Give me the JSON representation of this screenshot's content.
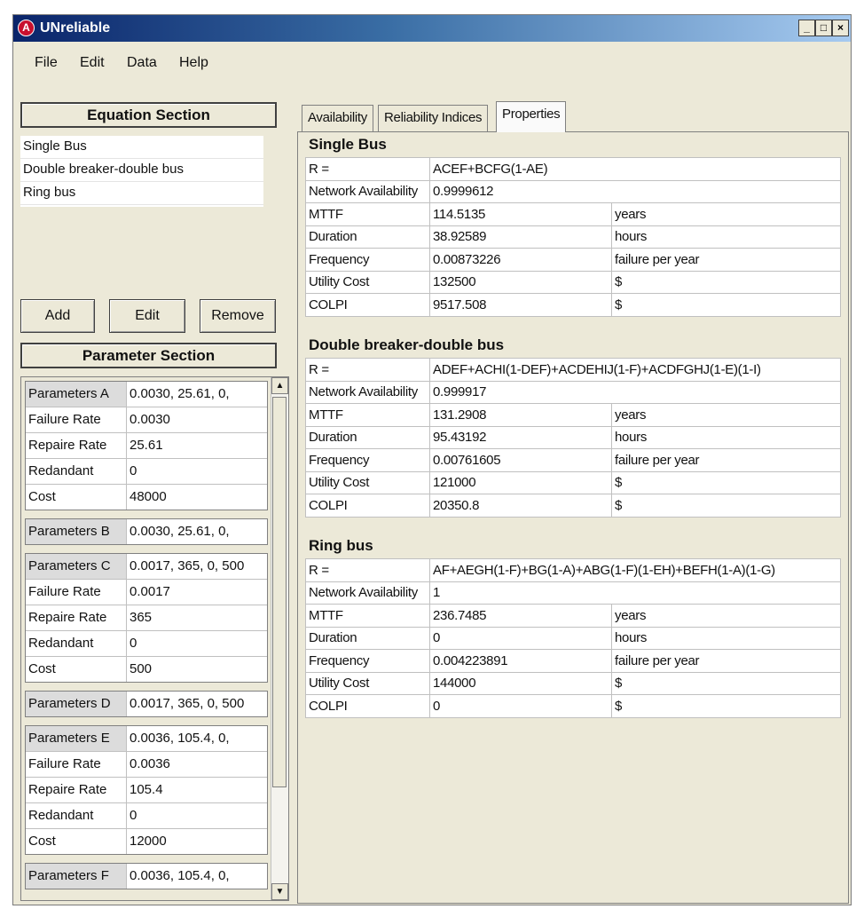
{
  "window": {
    "title": "UNreliable"
  },
  "titlebar_buttons": {
    "minimize": "_",
    "maximize": "□",
    "close": "×"
  },
  "menu": [
    "File",
    "Edit",
    "Data",
    "Help"
  ],
  "equation_section": {
    "title": "Equation Section",
    "items": [
      "Single Bus",
      "Double breaker-double bus",
      "Ring bus"
    ],
    "buttons": {
      "add": "Add",
      "edit": "Edit",
      "remove": "Remove"
    }
  },
  "parameter_section": {
    "title": "Parameter Section",
    "groups": [
      {
        "header": "Parameters A",
        "summary": "0.0030, 25.61, 0,",
        "expanded": true,
        "rows": [
          [
            "Failure Rate",
            "0.0030"
          ],
          [
            "Repaire Rate",
            "25.61"
          ],
          [
            "Redandant",
            "0"
          ],
          [
            "Cost",
            "48000"
          ]
        ]
      },
      {
        "header": "Parameters B",
        "summary": "0.0030, 25.61, 0,",
        "expanded": false,
        "rows": []
      },
      {
        "header": "Parameters C",
        "summary": "0.0017, 365, 0, 500",
        "expanded": true,
        "rows": [
          [
            "Failure Rate",
            "0.0017"
          ],
          [
            "Repaire Rate",
            "365"
          ],
          [
            "Redandant",
            "0"
          ],
          [
            "Cost",
            "500"
          ]
        ]
      },
      {
        "header": "Parameters D",
        "summary": "0.0017, 365, 0, 500",
        "expanded": false,
        "rows": []
      },
      {
        "header": "Parameters E",
        "summary": "0.0036, 105.4, 0,",
        "expanded": true,
        "rows": [
          [
            "Failure Rate",
            "0.0036"
          ],
          [
            "Repaire Rate",
            "105.4"
          ],
          [
            "Redandant",
            "0"
          ],
          [
            "Cost",
            "12000"
          ]
        ]
      },
      {
        "header": "Parameters F",
        "summary": "0.0036, 105.4, 0,",
        "expanded": false,
        "rows": []
      }
    ],
    "scroll_up": "▲",
    "scroll_down": "▼"
  },
  "tabs": [
    "Availability",
    "Reliability Indices",
    "Properties"
  ],
  "active_tab": "Properties",
  "properties": [
    {
      "title": "Single Bus",
      "rows": [
        [
          "R =",
          "ACEF+BCFG(1-AE)",
          ""
        ],
        [
          "Network Availability",
          "0.9999612",
          ""
        ],
        [
          "MTTF",
          "114.5135",
          "years"
        ],
        [
          "Duration",
          "38.92589",
          "hours"
        ],
        [
          "Frequency",
          "0.00873226",
          "failure per year"
        ],
        [
          "Utility Cost",
          "132500",
          "$"
        ],
        [
          "COLPI",
          "9517.508",
          "$"
        ]
      ]
    },
    {
      "title": "Double breaker-double bus",
      "rows": [
        [
          "R =",
          "ADEF+ACHI(1-DEF)+ACDEHIJ(1-F)+ACDFGHJ(1-E)(1-I)",
          ""
        ],
        [
          "Network Availability",
          "0.999917",
          ""
        ],
        [
          "MTTF",
          "131.2908",
          "years"
        ],
        [
          "Duration",
          "95.43192",
          "hours"
        ],
        [
          "Frequency",
          "0.00761605",
          "failure per year"
        ],
        [
          "Utility Cost",
          "121000",
          "$"
        ],
        [
          "COLPI",
          "20350.8",
          "$"
        ]
      ]
    },
    {
      "title": "Ring bus",
      "rows": [
        [
          "R =",
          "AF+AEGH(1-F)+BG(1-A)+ABG(1-F)(1-EH)+BEFH(1-A)(1-G)",
          ""
        ],
        [
          "Network Availability",
          "1",
          ""
        ],
        [
          "MTTF",
          "236.7485",
          "years"
        ],
        [
          "Duration",
          "0",
          "hours"
        ],
        [
          "Frequency",
          "0.004223891",
          "failure per year"
        ],
        [
          "Utility Cost",
          "144000",
          "$"
        ],
        [
          "COLPI",
          "0",
          "$"
        ]
      ]
    }
  ]
}
